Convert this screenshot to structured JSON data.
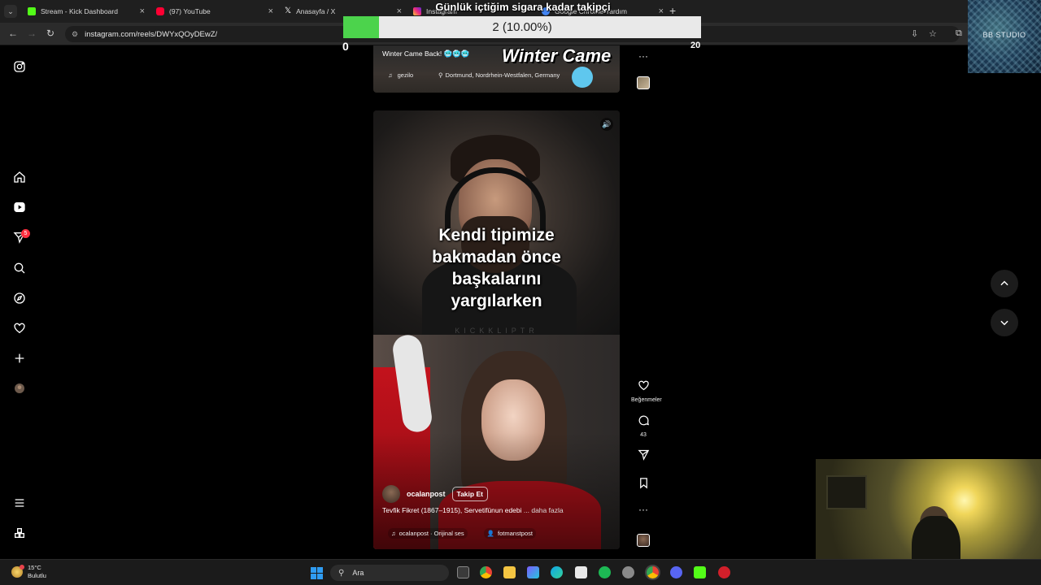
{
  "browser": {
    "tabs": [
      {
        "label": "Stream - Kick Dashboard",
        "color": "#53fc18"
      },
      {
        "label": "(97) YouTube",
        "color": "#ff0033"
      },
      {
        "label": "Anasayfa / X",
        "color": "#ffffff"
      },
      {
        "label": "Instagram",
        "color": "#e1306c"
      },
      {
        "label": "Google Chrome Yardım",
        "color": "#4285f4"
      }
    ],
    "url": "instagram.com/reels/DWYxQOyDEwZ/"
  },
  "goal": {
    "title": "Günlük içtiğim sigara kadar takipçi",
    "progress_text": "2 (10.00%)",
    "progress_fraction": 0.1,
    "min": "0",
    "max": "20",
    "fill_color": "#4cd34c"
  },
  "studio_logo": "BB STUDIO",
  "sidebar": {
    "items": [
      "instagram-logo-icon",
      "home-icon",
      "reels-icon",
      "messages-icon",
      "search-icon",
      "explore-icon",
      "notifications-icon",
      "create-icon",
      "profile-icon",
      "menu-icon",
      "meta-apps-icon"
    ],
    "messages_badge": "5"
  },
  "reel_prev": {
    "caption": "Winter Came Back! 🥶🥶🥶",
    "overlay_text": "Winter Came",
    "audio": "gezilo",
    "location": "Dortmund, Nordrhein-Westfalen, Germany"
  },
  "reel": {
    "overlay_lines": [
      "Kendi tipimize",
      "bakmadan önce",
      "başkalarını",
      "yargılarken"
    ],
    "watermark": "KICKKLIPTR",
    "author": "ocalanpost",
    "follow_label": "Takip Et",
    "caption": "Tevfik Fikret (1867–1915), Servetifünun edebi",
    "caption_more": "... daha fazla",
    "audio": "ocalanpost · Orijinal ses",
    "tagged_user": "fotmanstpost"
  },
  "actions": {
    "like_label": "Beğenmeler",
    "comment_count": "43"
  },
  "taskbar": {
    "temperature": "15°C",
    "condition": "Bulutlu",
    "search_placeholder": "Ara"
  }
}
